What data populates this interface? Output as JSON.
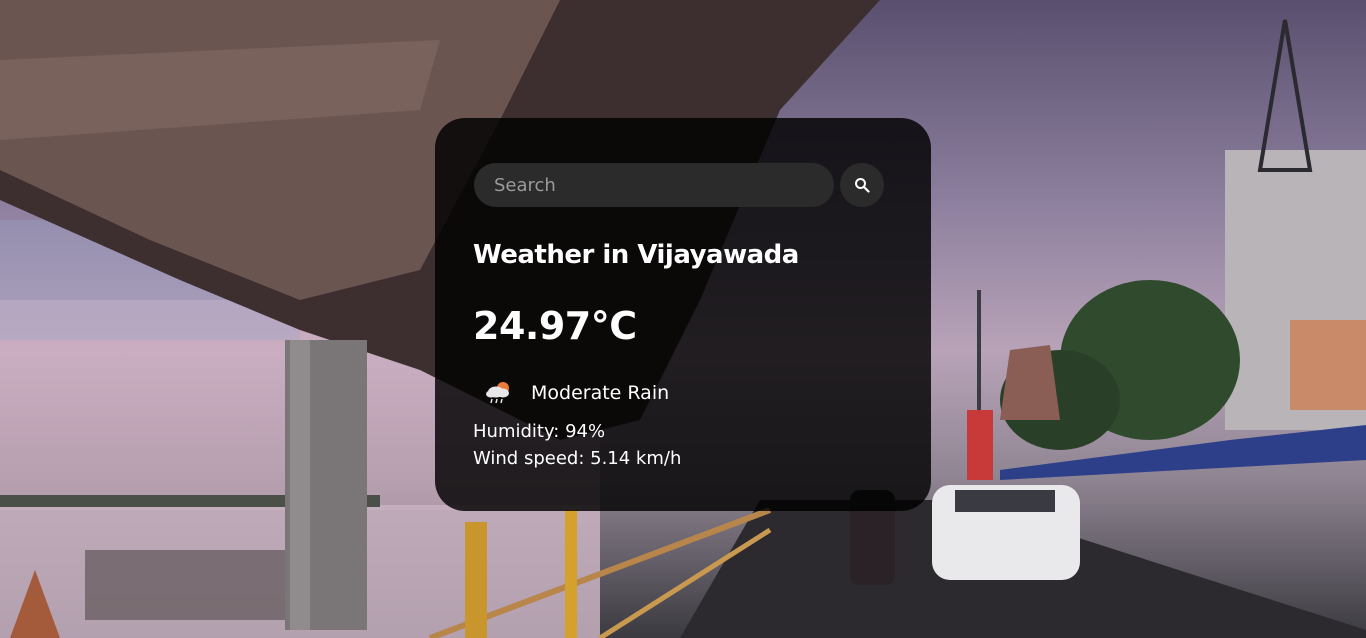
{
  "search": {
    "placeholder": "Search",
    "value": ""
  },
  "weather": {
    "city_heading": "Weather in Vijayawada",
    "temperature": "24.97°C",
    "condition": "Moderate Rain",
    "condition_icon": "rain-cloud-sun-icon",
    "humidity": "Humidity: 94%",
    "wind": "Wind speed: 5.14 km/h"
  },
  "colors": {
    "card_background": "#000000",
    "search_field": "#2b2b2b",
    "text": "#ffffff"
  }
}
